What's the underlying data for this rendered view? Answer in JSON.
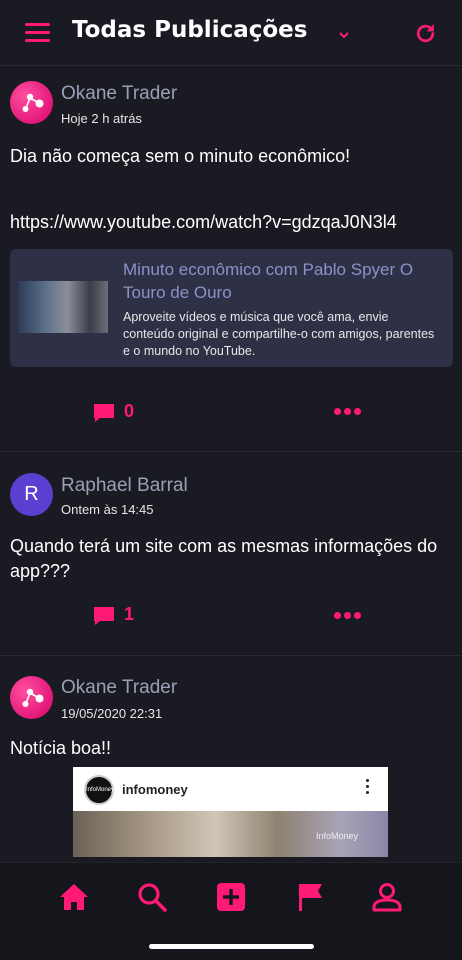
{
  "header": {
    "title": "Todas Publicações",
    "accent": "#ff1a75"
  },
  "posts": [
    {
      "author": "Okane Trader",
      "time": "Hoje 2 h atrás",
      "text_line1": "Dia não começa sem o minuto econômico!",
      "text_line2": "https://www.youtube.com/watch?v=gdzqaJ0N3l4",
      "link_card": {
        "title": "Minuto econômico com Pablo Spyer O Touro de Ouro",
        "description": "Aproveite vídeos e música que você ama, envie conteúdo original e compartilhe-o com amigos, parentes e o mundo no YouTube."
      },
      "comments": "0"
    },
    {
      "author": "Raphael Barral",
      "avatar_letter": "R",
      "time": "Ontem às 14:45",
      "text": "Quando terá um site com as mesmas informações do app???",
      "comments": "1"
    },
    {
      "author": "Okane Trader",
      "time": "19/05/2020 22:31",
      "text": "Notícia boa!!",
      "image_preview": {
        "account_name": "infomoney",
        "avatar_text": "InfoMoney",
        "watermark": "InfoMoney"
      }
    }
  ],
  "tabbar": {
    "items": [
      "home-icon",
      "search-icon",
      "add-post-icon",
      "flag-icon",
      "profile-icon"
    ]
  }
}
